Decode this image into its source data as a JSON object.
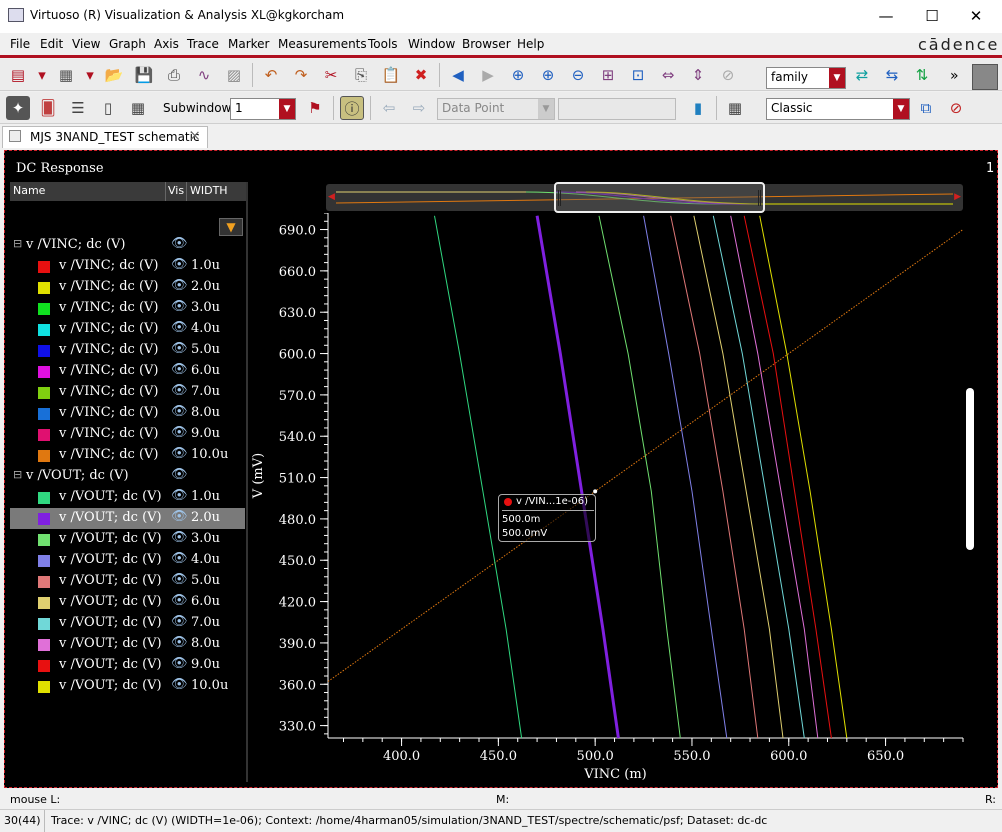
{
  "window": {
    "title": "Virtuoso (R) Visualization & Analysis XL@kgkorcham",
    "minimize": "—",
    "maximize": "☐",
    "close": "✕"
  },
  "menu": [
    "File",
    "Edit",
    "View",
    "Graph",
    "Axis",
    "Trace",
    "Marker",
    "Measurements",
    "Tools",
    "Window",
    "Browser",
    "Help"
  ],
  "brand": "cādence",
  "toolbar1": {
    "family_value": "family",
    "more": "»"
  },
  "toolbar2": {
    "subwindow_label": "Subwindow:",
    "subwindow_value": "1",
    "data_point_placeholder": "Data Point",
    "classic_value": "Classic"
  },
  "tab": {
    "label": "MJS 3NAND_TEST schematic",
    "close": "×"
  },
  "panel": {
    "title": "DC Response",
    "sheet": "1"
  },
  "tree": {
    "headers": {
      "name": "Name",
      "vis": "Vis",
      "width": "WIDTH"
    },
    "groups": [
      {
        "label": "v /VINC; dc (V)",
        "items": [
          {
            "label": "v /VINC; dc (V)",
            "width": "1.0u",
            "color": "#e81010"
          },
          {
            "label": "v /VINC; dc (V)",
            "width": "2.0u",
            "color": "#e0e000"
          },
          {
            "label": "v /VINC; dc (V)",
            "width": "3.0u",
            "color": "#10e020"
          },
          {
            "label": "v /VINC; dc (V)",
            "width": "4.0u",
            "color": "#10e0e0"
          },
          {
            "label": "v /VINC; dc (V)",
            "width": "5.0u",
            "color": "#1010e8"
          },
          {
            "label": "v /VINC; dc (V)",
            "width": "6.0u",
            "color": "#e010e0"
          },
          {
            "label": "v /VINC; dc (V)",
            "width": "7.0u",
            "color": "#80d010"
          },
          {
            "label": "v /VINC; dc (V)",
            "width": "8.0u",
            "color": "#1870d8"
          },
          {
            "label": "v /VINC; dc (V)",
            "width": "9.0u",
            "color": "#e01070"
          },
          {
            "label": "v /VINC; dc (V)",
            "width": "10.0u",
            "color": "#e07810"
          }
        ]
      },
      {
        "label": "v /VOUT; dc (V)",
        "items": [
          {
            "label": "v /VOUT; dc (V)",
            "width": "1.0u",
            "color": "#30d880"
          },
          {
            "label": "v /VOUT; dc (V)",
            "width": "2.0u",
            "color": "#8020e0",
            "selected": true
          },
          {
            "label": "v /VOUT; dc (V)",
            "width": "3.0u",
            "color": "#70e070"
          },
          {
            "label": "v /VOUT; dc (V)",
            "width": "4.0u",
            "color": "#8080e8"
          },
          {
            "label": "v /VOUT; dc (V)",
            "width": "5.0u",
            "color": "#e07878"
          },
          {
            "label": "v /VOUT; dc (V)",
            "width": "6.0u",
            "color": "#e0d070"
          },
          {
            "label": "v /VOUT; dc (V)",
            "width": "7.0u",
            "color": "#70d8d8"
          },
          {
            "label": "v /VOUT; dc (V)",
            "width": "8.0u",
            "color": "#e070d8"
          },
          {
            "label": "v /VOUT; dc (V)",
            "width": "9.0u",
            "color": "#e81010"
          },
          {
            "label": "v /VOUT; dc (V)",
            "width": "10.0u",
            "color": "#e0e000"
          }
        ]
      }
    ]
  },
  "marker": {
    "label": "v /VIN...1e-06)",
    "x_value": "500.0m",
    "y_value": "500.0mV"
  },
  "chart_data": {
    "type": "line",
    "xlabel": "VINC (m)",
    "ylabel": "V (mV)",
    "xlim": [
      362,
      690
    ],
    "ylim": [
      321,
      702
    ],
    "x_ticks": [
      "400.0",
      "450.0",
      "500.0",
      "550.0",
      "600.0",
      "650.0"
    ],
    "x_tick_values": [
      400,
      450,
      500,
      550,
      600,
      650
    ],
    "y_ticks": [
      "330.0",
      "360.0",
      "390.0",
      "420.0",
      "450.0",
      "480.0",
      "510.0",
      "540.0",
      "570.0",
      "600.0",
      "630.0",
      "660.0",
      "690.0"
    ],
    "y_tick_values": [
      330,
      360,
      390,
      420,
      450,
      480,
      510,
      540,
      570,
      600,
      630,
      660,
      690
    ],
    "series": [
      {
        "width": "10.0u",
        "color": "#e07810",
        "style": "dotted",
        "x": [
          362,
          690
        ],
        "y": [
          362,
          690
        ]
      },
      {
        "width": "1.0u",
        "color": "#30d880",
        "x": [
          417,
          430,
          442,
          454,
          462
        ],
        "y": [
          700,
          600,
          500,
          400,
          321
        ]
      },
      {
        "width": "2.0u",
        "color": "#8020e0",
        "bold": true,
        "x": [
          470,
          482,
          493,
          504,
          512
        ],
        "y": [
          700,
          600,
          500,
          400,
          321
        ]
      },
      {
        "width": "3.0u",
        "color": "#70e070",
        "x": [
          502,
          517,
          529,
          537,
          544
        ],
        "y": [
          700,
          600,
          500,
          400,
          321
        ]
      },
      {
        "width": "4.0u",
        "color": "#8080e8",
        "x": [
          525,
          538,
          550,
          560,
          568
        ],
        "y": [
          700,
          600,
          500,
          400,
          321
        ]
      },
      {
        "width": "5.0u",
        "color": "#e07878",
        "x": [
          539,
          554,
          566,
          577,
          584
        ],
        "y": [
          700,
          600,
          500,
          400,
          321
        ]
      },
      {
        "width": "6.0u",
        "color": "#e0d070",
        "x": [
          551,
          566,
          578,
          590,
          597
        ],
        "y": [
          700,
          600,
          500,
          400,
          321
        ]
      },
      {
        "width": "7.0u",
        "color": "#70d8d8",
        "x": [
          561,
          576,
          588,
          600,
          608
        ],
        "y": [
          700,
          600,
          500,
          400,
          321
        ]
      },
      {
        "width": "8.0u",
        "color": "#e070d8",
        "x": [
          570,
          584,
          596,
          608,
          615
        ],
        "y": [
          700,
          600,
          500,
          400,
          321
        ]
      },
      {
        "width": "9.0u",
        "color": "#e81010",
        "x": [
          577,
          592,
          603,
          614,
          622
        ],
        "y": [
          700,
          600,
          500,
          400,
          321
        ]
      },
      {
        "width": "10.0u",
        "color": "#e0e000",
        "x": [
          585,
          599,
          611,
          622,
          630
        ],
        "y": [
          700,
          600,
          500,
          400,
          321
        ]
      }
    ]
  },
  "status": {
    "mouse_label": "mouse L:",
    "m_label": "M:",
    "r_label": "R:",
    "count": "30(44)",
    "trace_info": "Trace: v /VINC; dc (V) (WIDTH=1e-06); Context: /home/4harman05/simulation/3NAND_TEST/spectre/schematic/psf; Dataset: dc-dc"
  }
}
